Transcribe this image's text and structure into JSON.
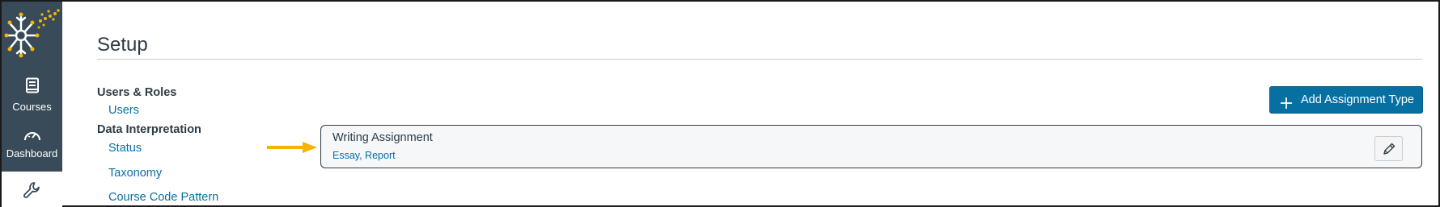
{
  "nav": {
    "logo_icon": "snowflake-logo-icon",
    "items": [
      {
        "label": "Courses",
        "icon": "book-icon"
      },
      {
        "label": "Dashboard",
        "icon": "speedometer-icon"
      }
    ],
    "active_icon": "wrench-icon"
  },
  "page": {
    "title": "Setup"
  },
  "sidebar": {
    "sections": [
      {
        "heading": "Users & Roles",
        "links": [
          "Users"
        ]
      },
      {
        "heading": "Data Interpretation",
        "links": [
          "Status",
          "Taxonomy",
          "Course Code Pattern"
        ]
      }
    ]
  },
  "toolbar": {
    "add_label": "Add Assignment Type",
    "add_icon": "plus-icon"
  },
  "assignment_types": [
    {
      "name": "Writing Assignment",
      "subtypes": "Essay, Report",
      "edit_icon": "pencil-icon"
    }
  ],
  "colors": {
    "nav_bg": "#394b58",
    "link": "#0770a3",
    "primary_button": "#0770a3",
    "arrow": "#f5b400",
    "logo_accent": "#f5b400"
  }
}
